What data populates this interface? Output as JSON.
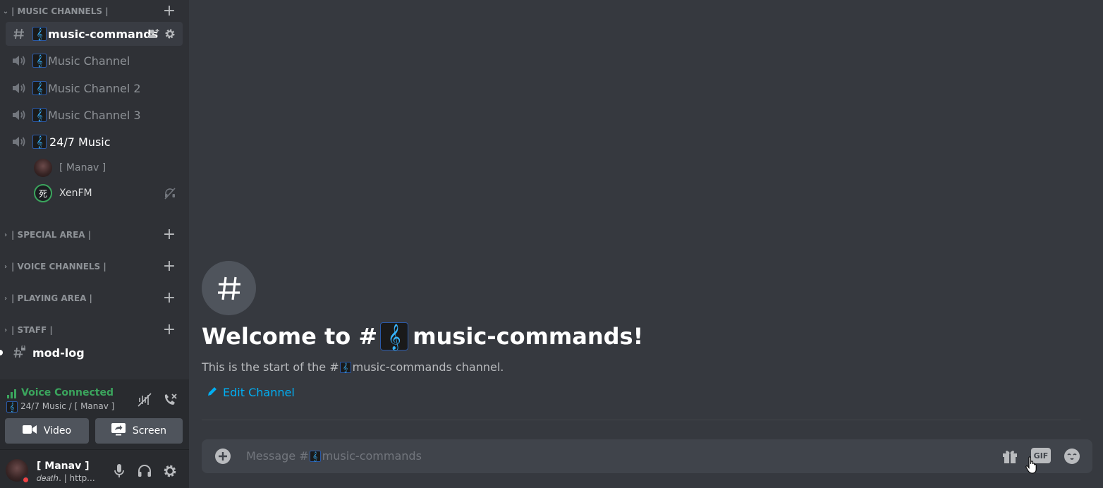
{
  "sidebar": {
    "categories": [
      {
        "label": "| MUSIC CHANNELS |"
      },
      {
        "label": "| SPECIAL AREA |"
      },
      {
        "label": "| VOICE CHANNELS |"
      },
      {
        "label": "| PLAYING AREA |"
      },
      {
        "label": "| STAFF |"
      }
    ],
    "channels": [
      {
        "name": "music-commands",
        "type": "text",
        "selected": true
      },
      {
        "name": "Music Channel",
        "type": "voice"
      },
      {
        "name": "Music Channel 2",
        "type": "voice"
      },
      {
        "name": "Music Channel 3",
        "type": "voice"
      },
      {
        "name": "24/7 Music",
        "type": "voice",
        "active": true
      }
    ],
    "voice_users": [
      {
        "name": "[ Manav ]"
      },
      {
        "name": "XenFM",
        "avatar_text": "死"
      }
    ],
    "staff_channel": {
      "name": "mod-log"
    }
  },
  "voice_panel": {
    "status": "Voice Connected",
    "location": "24/7 Music / [ Manav ]",
    "video_label": "Video",
    "screen_label": "Screen"
  },
  "user_panel": {
    "username": "[ Manav ]",
    "status_text": "𝑑𝑒𝑎𝑡ℎ. | http..."
  },
  "welcome": {
    "title_prefix": "Welcome to #",
    "title_channel": "music-commands!",
    "subtitle_prefix": "This is the start of the #",
    "subtitle_suffix": "music-commands channel.",
    "edit_label": "Edit Channel"
  },
  "composer": {
    "placeholder_prefix": "Message #",
    "placeholder_channel": "music-commands",
    "gif_label": "GIF"
  },
  "emoji": "𝄞",
  "colors": {
    "accent_green": "#3ba55d",
    "link_blue": "#00aff4",
    "sidebar_bg": "#2f3136",
    "main_bg": "#36393f"
  }
}
